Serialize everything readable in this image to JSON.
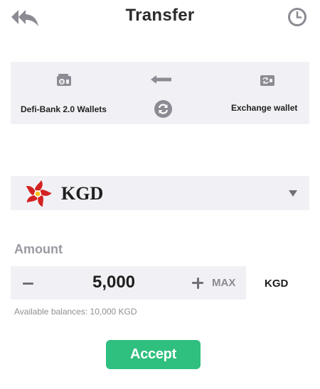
{
  "header": {
    "title": "Transfer",
    "back_icon": "double-reply-arrow-icon",
    "history_icon": "clock-icon"
  },
  "direction": {
    "from_label": "Defi-Bank 2.0 Wallets",
    "from_icon": "wallet-coin-icon",
    "to_label": "Exchange wallet",
    "to_icon": "exchange-wallet-icon",
    "arrow_icon": "arrow-left-icon",
    "swap_icon": "swap-circle-icon"
  },
  "currency": {
    "code": "KGD",
    "logo_icon": "red-flower-logo-icon",
    "dropdown_icon": "caret-down-icon"
  },
  "amount": {
    "label": "Amount",
    "value": "5,000",
    "max_label": "MAX",
    "unit": "KGD",
    "available": "Available balances: 10,000 KGD"
  },
  "accept_label": "Accept",
  "colors": {
    "accent": "#2fbf7e",
    "panel": "#f1f1f5",
    "icon_gray": "#8b8b93",
    "logo_red": "#d42222",
    "logo_gold": "#f2c21b"
  }
}
